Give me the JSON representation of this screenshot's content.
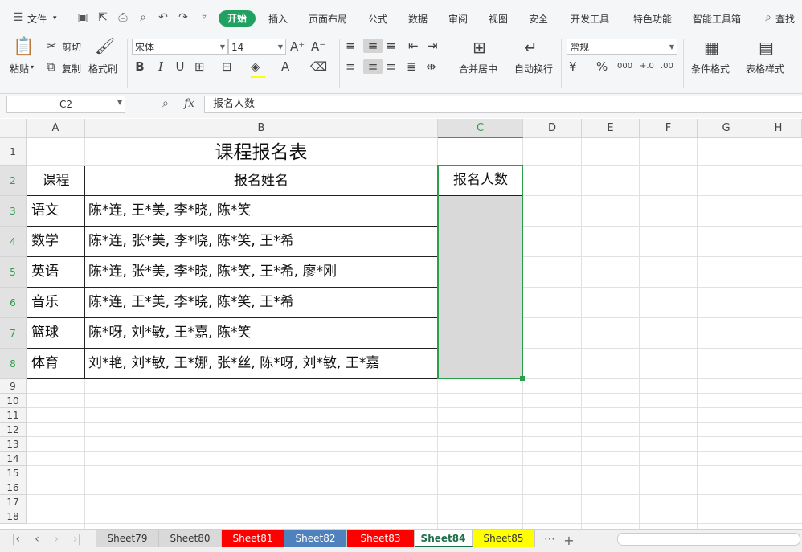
{
  "menu": {
    "file": "文件",
    "tabs": [
      "开始",
      "插入",
      "页面布局",
      "公式",
      "数据",
      "审阅",
      "视图",
      "安全",
      "开发工具",
      "特色功能",
      "智能工具箱"
    ],
    "active_tab": "开始",
    "search": "查找"
  },
  "ribbon": {
    "paste": "粘贴",
    "cut": "剪切",
    "copy": "复制",
    "format_painter": "格式刷",
    "font_name": "宋体",
    "font_size": "14",
    "merge_center": "合并居中",
    "wrap_text": "自动换行",
    "number_format": "常规",
    "conditional_format": "条件格式",
    "table_style": "表格样式"
  },
  "formula_bar": {
    "name_box": "C2",
    "fx": "fx",
    "content": "报名人数"
  },
  "sheet": {
    "columns": [
      "A",
      "B",
      "C",
      "D",
      "E",
      "F",
      "G",
      "H"
    ],
    "active_column": "C",
    "row_numbers": [
      "1",
      "2",
      "3",
      "4",
      "5",
      "6",
      "7",
      "8",
      "9",
      "10",
      "11",
      "12",
      "13",
      "14",
      "15",
      "16",
      "17",
      "18"
    ],
    "title": "课程报名表",
    "header": {
      "course": "课程",
      "names": "报名姓名",
      "count": "报名人数"
    },
    "rows": [
      {
        "course": "语文",
        "names": "陈*连, 王*美, 李*晓, 陈*笑"
      },
      {
        "course": "数学",
        "names": "陈*连, 张*美, 李*晓, 陈*笑, 王*希"
      },
      {
        "course": "英语",
        "names": "陈*连, 张*美, 李*晓, 陈*笑, 王*希, 廖*刚"
      },
      {
        "course": "音乐",
        "names": "陈*连, 王*美, 李*晓, 陈*笑, 王*希"
      },
      {
        "course": "篮球",
        "names": "陈*呀, 刘*敏, 王*嘉, 陈*笑"
      },
      {
        "course": "体育",
        "names": "刘*艳, 刘*敏, 王*娜, 张*丝, 陈*呀, 刘*敏, 王*嘉"
      }
    ]
  },
  "tabs": [
    {
      "name": "Sheet79",
      "color": "#d9d9d9",
      "active": false
    },
    {
      "name": "Sheet80",
      "color": "#d9d9d9",
      "active": false
    },
    {
      "name": "Sheet81",
      "color": "#ff0000",
      "active": false
    },
    {
      "name": "Sheet82",
      "color": "#4f81bd",
      "active": false
    },
    {
      "name": "Sheet83",
      "color": "#ff0000",
      "active": false
    },
    {
      "name": "Sheet84",
      "color": "#ffffff",
      "active": true
    },
    {
      "name": "Sheet85",
      "color": "#ffff00",
      "active": false
    }
  ],
  "colors": {
    "accent": "#20a162",
    "selection": "#2c9e4b",
    "selected_fill": "#d9d9d9"
  }
}
